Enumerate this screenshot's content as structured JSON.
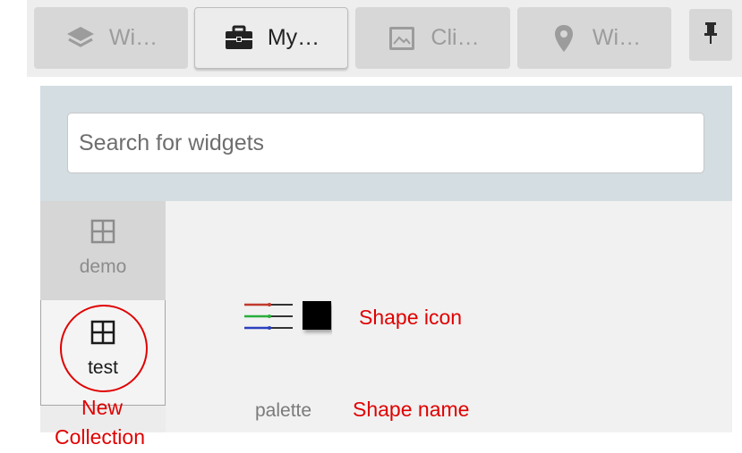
{
  "tabs": [
    {
      "label": "Wi…",
      "icon": "layers-icon",
      "active": false
    },
    {
      "label": "My…",
      "icon": "briefcase-icon",
      "active": true
    },
    {
      "label": "Cli…",
      "icon": "image-icon",
      "active": false
    },
    {
      "label": "Wi…",
      "icon": "map-pin-icon",
      "active": false
    }
  ],
  "pin": {
    "icon": "pin-icon"
  },
  "search": {
    "placeholder": "Search for widgets"
  },
  "collections": [
    {
      "label": "demo",
      "icon": "grid-icon",
      "selected": false
    },
    {
      "label": "test",
      "icon": "grid-icon",
      "selected": true
    }
  ],
  "widgets": [
    {
      "name": "palette",
      "icon": "palette-shape-icon"
    }
  ],
  "annotations": {
    "shape_icon": "Shape icon",
    "shape_name": "Shape name",
    "new_collection_line1": "New",
    "new_collection_line2": "Collection"
  },
  "colors": {
    "annotation": "#e00000",
    "panel_background": "#d3dde2",
    "active_tab": "#ececec",
    "inactive_tab": "#d7d7d7"
  }
}
